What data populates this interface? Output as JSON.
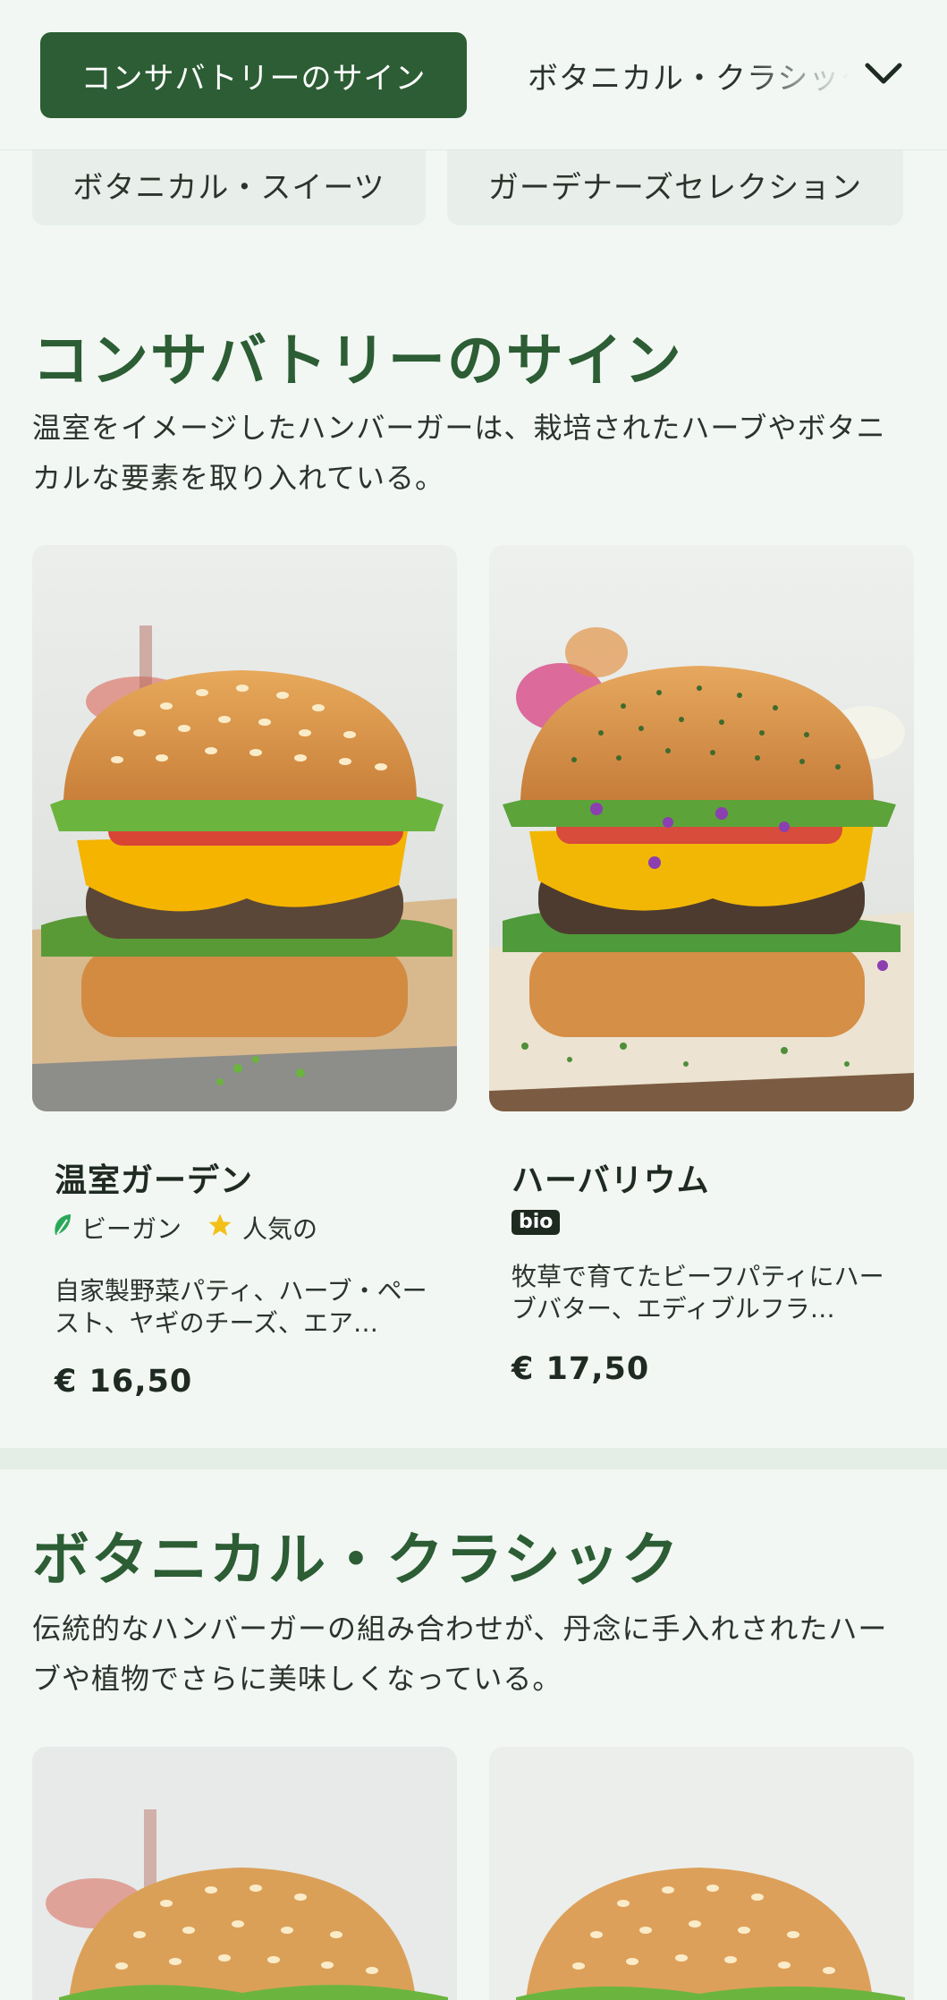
{
  "nav": {
    "active_tab": "コンサバトリーのサイン",
    "next_tab": "ボタニカル・クラシック",
    "chips": [
      "ボタニカル・スイーツ",
      "ガーデナーズセレクション"
    ]
  },
  "sections": [
    {
      "title": "コンサバトリーのサイン",
      "description": "温室をイメージしたハンバーガーは、栽培されたハーブやボタニカルな要素を取り入れている。",
      "items": [
        {
          "name": "温室ガーデン",
          "tags": [
            "ビーガン",
            "人気の"
          ],
          "description": "自家製野菜パティ、ハーブ・ペースト、ヤギのチーズ、エア…",
          "price": "€ 16,50"
        },
        {
          "name": "ハーバリウム",
          "badge": "bio",
          "description": "牧草で育てたビーフパティにハーブバター、エディブルフラ…",
          "price": "€ 17,50"
        }
      ]
    },
    {
      "title": "ボタニカル・クラシック",
      "description": "伝統的なハンバーガーの組み合わせが、丹念に手入れされたハーブや植物でさらに美味しくなっている。"
    }
  ],
  "colors": {
    "brand_green": "#2c5d34",
    "background": "#f2f7f3",
    "chip_bg": "#e8efea",
    "vegan_leaf": "#2aa85a",
    "popular_star": "#f3c018"
  },
  "icons": {
    "dropdown": "chevron-down-icon",
    "vegan": "leaf-icon",
    "popular": "star-icon"
  }
}
